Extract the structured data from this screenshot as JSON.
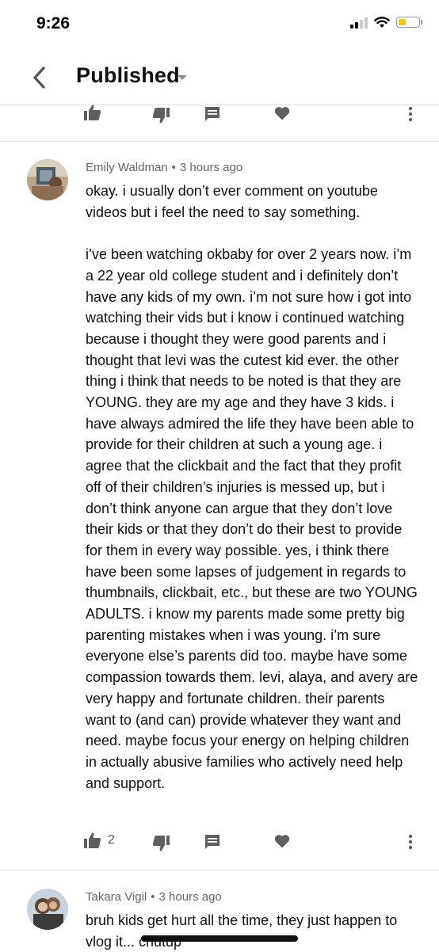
{
  "status_bar": {
    "time": "9:26"
  },
  "header": {
    "title": "Published"
  },
  "comments": [
    {
      "author": "Emily Waldman",
      "separator": "•",
      "time_ago": "3 hours ago",
      "text": "okay. i usually don’t ever comment on youtube videos but i feel the need to say something.\n\ni’ve been watching okbaby for over 2 years now. i’m a 22 year old college student and i definitely don’t have any kids of my own. i’m not sure how i got into watching their vids but i know i continued watching because i thought they were good parents and i thought that levi was the cutest kid ever. the other thing i think that needs to be noted is that they are YOUNG. they are my age and they have 3 kids. i have always admired the life they have been able to provide for their children at such a young age. i agree that the clickbait and the fact that they profit off of their children’s injuries is messed up, but i don’t think anyone can argue that they don’t love their kids or that they don’t do their best to provide for them in every way possible. yes, i think there have been some lapses of judgement in regards to thumbnails, clickbait, etc., but these are two YOUNG ADULTS. i know my parents made some pretty big parenting mistakes when i was young. i’m sure everyone else’s parents did too. maybe have some compassion towards them. levi, alaya, and avery are very happy and fortunate children. their parents want to (and can) provide whatever they want and need. maybe focus your energy on helping children in actually abusive families who actively need help and support.",
      "like_count": "2"
    },
    {
      "author": "Takara Vigil",
      "separator": "•",
      "time_ago": "3 hours ago",
      "text": "bruh kids get hurt all the time, they just happen to vlog it... chutup"
    }
  ],
  "icons": {
    "back": "chevron-left-icon",
    "dropdown": "caret-down-icon",
    "like": "thumbs-up-icon",
    "dislike": "thumbs-down-icon",
    "reply": "reply-icon",
    "heart": "heart-icon",
    "more": "more-vert-icon"
  },
  "colors": {
    "icon": "#5f5f5f",
    "battery": "#f2c418",
    "meta": "#666666"
  }
}
